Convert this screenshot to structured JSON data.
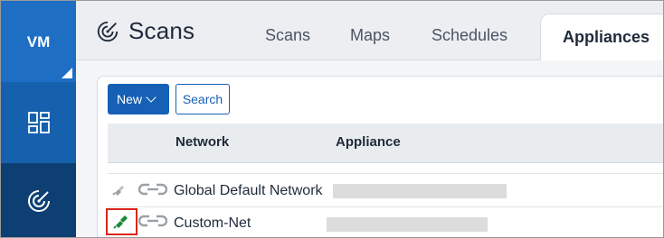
{
  "rail": {
    "brand": "VM"
  },
  "header": {
    "title": "Scans",
    "tabs": [
      {
        "label": "Scans"
      },
      {
        "label": "Maps"
      },
      {
        "label": "Schedules"
      },
      {
        "label": "Appliances"
      }
    ]
  },
  "toolbar": {
    "new_label": "New",
    "search_label": "Search"
  },
  "table": {
    "columns": [
      "Network",
      "Appliance"
    ],
    "rows": [
      {
        "network": "Global Default Network"
      },
      {
        "network": "Custom-Net"
      }
    ]
  },
  "colors": {
    "rail": "#0f4c8a",
    "rail_top": "#1e6ec4",
    "accent": "#1660b5",
    "highlight": "#d9261c",
    "status_active": "#1a8a3a"
  },
  "icons": {
    "rail_dashboard": "dashboard-icon",
    "rail_scans": "radar-icon",
    "title": "radar-icon",
    "row_status": "plug-icon",
    "row_link": "link-icon"
  }
}
